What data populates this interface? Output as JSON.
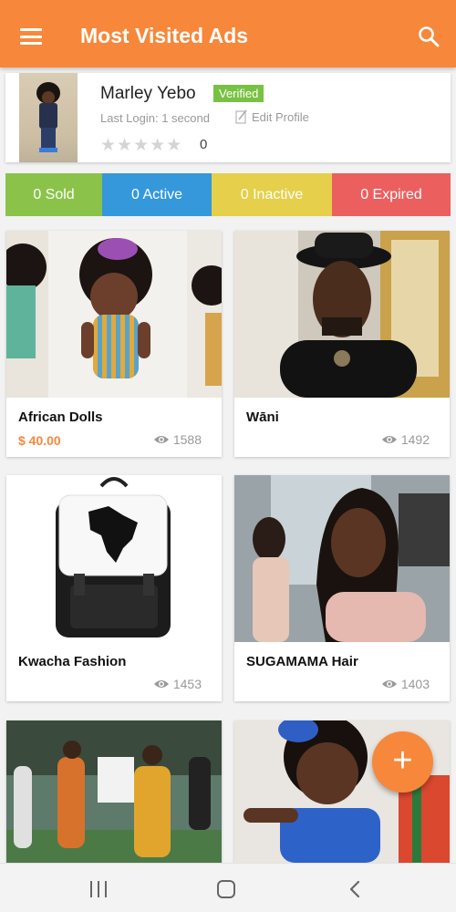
{
  "app_bar": {
    "title": "Most Visited Ads",
    "menu_icon": "hamburger-menu-icon",
    "search_icon": "search-icon",
    "background": "#f7873a"
  },
  "profile": {
    "name": "Marley Yebo",
    "verified_label": "Verified",
    "last_login": "Last Login: 1 second",
    "edit_label": "Edit Profile",
    "rating_count": "0",
    "stars": 5
  },
  "stats": [
    {
      "label": "0 Sold",
      "color": "#8bc34a"
    },
    {
      "label": "0 Active",
      "color": "#3498db"
    },
    {
      "label": "0 Inactive",
      "color": "#e6cf4a"
    },
    {
      "label": "0 Expired",
      "color": "#ec5f5f"
    }
  ],
  "ads": [
    {
      "title": "African Dolls",
      "price": "$ 40.00",
      "views": "1588"
    },
    {
      "title": "Wāni",
      "price": "",
      "views": "1492"
    },
    {
      "title": "Kwacha Fashion",
      "price": "",
      "views": "1453"
    },
    {
      "title": "SUGAMAMA Hair",
      "price": "",
      "views": "1403"
    },
    {
      "title": "",
      "price": "",
      "views": ""
    },
    {
      "title": "",
      "price": "",
      "views": ""
    }
  ],
  "fab": {
    "label": "+"
  },
  "system_nav": {
    "recents_icon": "recents-icon",
    "home_icon": "home-icon",
    "back_icon": "back-icon"
  }
}
